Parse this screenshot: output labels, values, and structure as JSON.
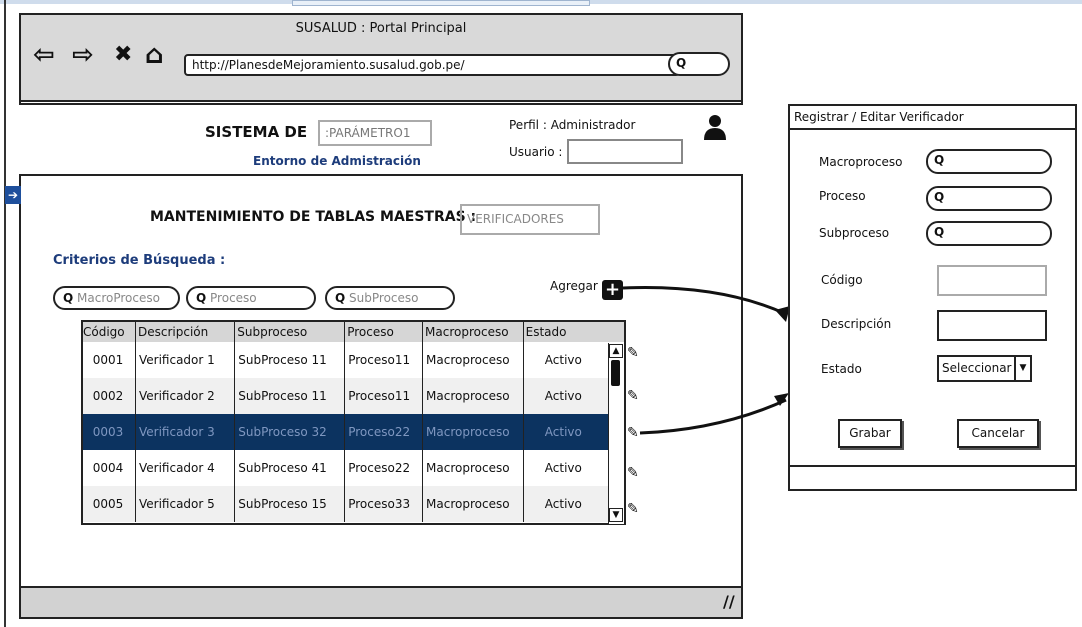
{
  "window": {
    "title": "SUSALUD : Portal Principal",
    "url": "http://PlanesdeMejoramiento.susalud.gob.pe/",
    "search_glyph": "Q"
  },
  "nav": {
    "back": "⇦",
    "forward": "⇨",
    "stop": "✖",
    "home": "⌂"
  },
  "header": {
    "system_label": "SISTEMA DE",
    "system_value": ":PARÁMETRO1",
    "subtitle": "Entorno de Admistración",
    "profile": "Perfil : Administrador",
    "user_label": "Usuario :"
  },
  "main": {
    "title": "MANTENIMIENTO DE TABLAS MAESTRAS :",
    "table_value": "VERIFICADORES",
    "criteria_label": "Criterios de Búsqueda :",
    "filters": [
      {
        "glyph": "Q",
        "placeholder": "MacroProceso"
      },
      {
        "glyph": "Q",
        "placeholder": "Proceso"
      },
      {
        "glyph": "Q",
        "placeholder": "SubProceso"
      }
    ],
    "add_label": "Agregar",
    "add_icon": "+"
  },
  "table": {
    "columns": [
      "Código",
      "Descripción",
      "Subproceso",
      "Proceso",
      "Macroproceso",
      "Estado"
    ],
    "rows": [
      [
        "0001",
        "Verificador 1",
        "SubProceso 11",
        "Proceso11",
        "Macroproceso",
        "Activo"
      ],
      [
        "0002",
        "Verificador 2",
        "SubProceso 11",
        "Proceso11",
        "Macroproceso",
        "Activo"
      ],
      [
        "0003",
        "Verificador 3",
        "SubProceso 32",
        "Proceso22",
        "Macroproceso",
        "Activo"
      ],
      [
        "0004",
        "Verificador 4",
        "SubProceso 41",
        "Proceso22",
        "Macroproceso",
        "Activo"
      ],
      [
        "0005",
        "Verificador 5",
        "SubProceso 15",
        "Proceso33",
        "Macroproceso",
        "Activo"
      ]
    ],
    "selected_row": 2,
    "edit_icon": "✎",
    "scroll_up": "▲",
    "scroll_down": "▼"
  },
  "footer": {
    "resize_glyph": "//"
  },
  "panel": {
    "title": "Registrar / Editar Verificador",
    "macroproceso_label": "Macroproceso",
    "proceso_label": "Proceso",
    "subproceso_label": "Subproceso",
    "codigo_label": "Código",
    "descripcion_label": "Descripción",
    "estado_label": "Estado",
    "estado_value": "Seleccionar",
    "search_glyph": "Q",
    "save_label": "Grabar",
    "cancel_label": "Cancelar"
  },
  "colors": {
    "accent": "#1d3c7b",
    "selected_row": "#0c3360",
    "chrome": "#d9d9d9"
  }
}
